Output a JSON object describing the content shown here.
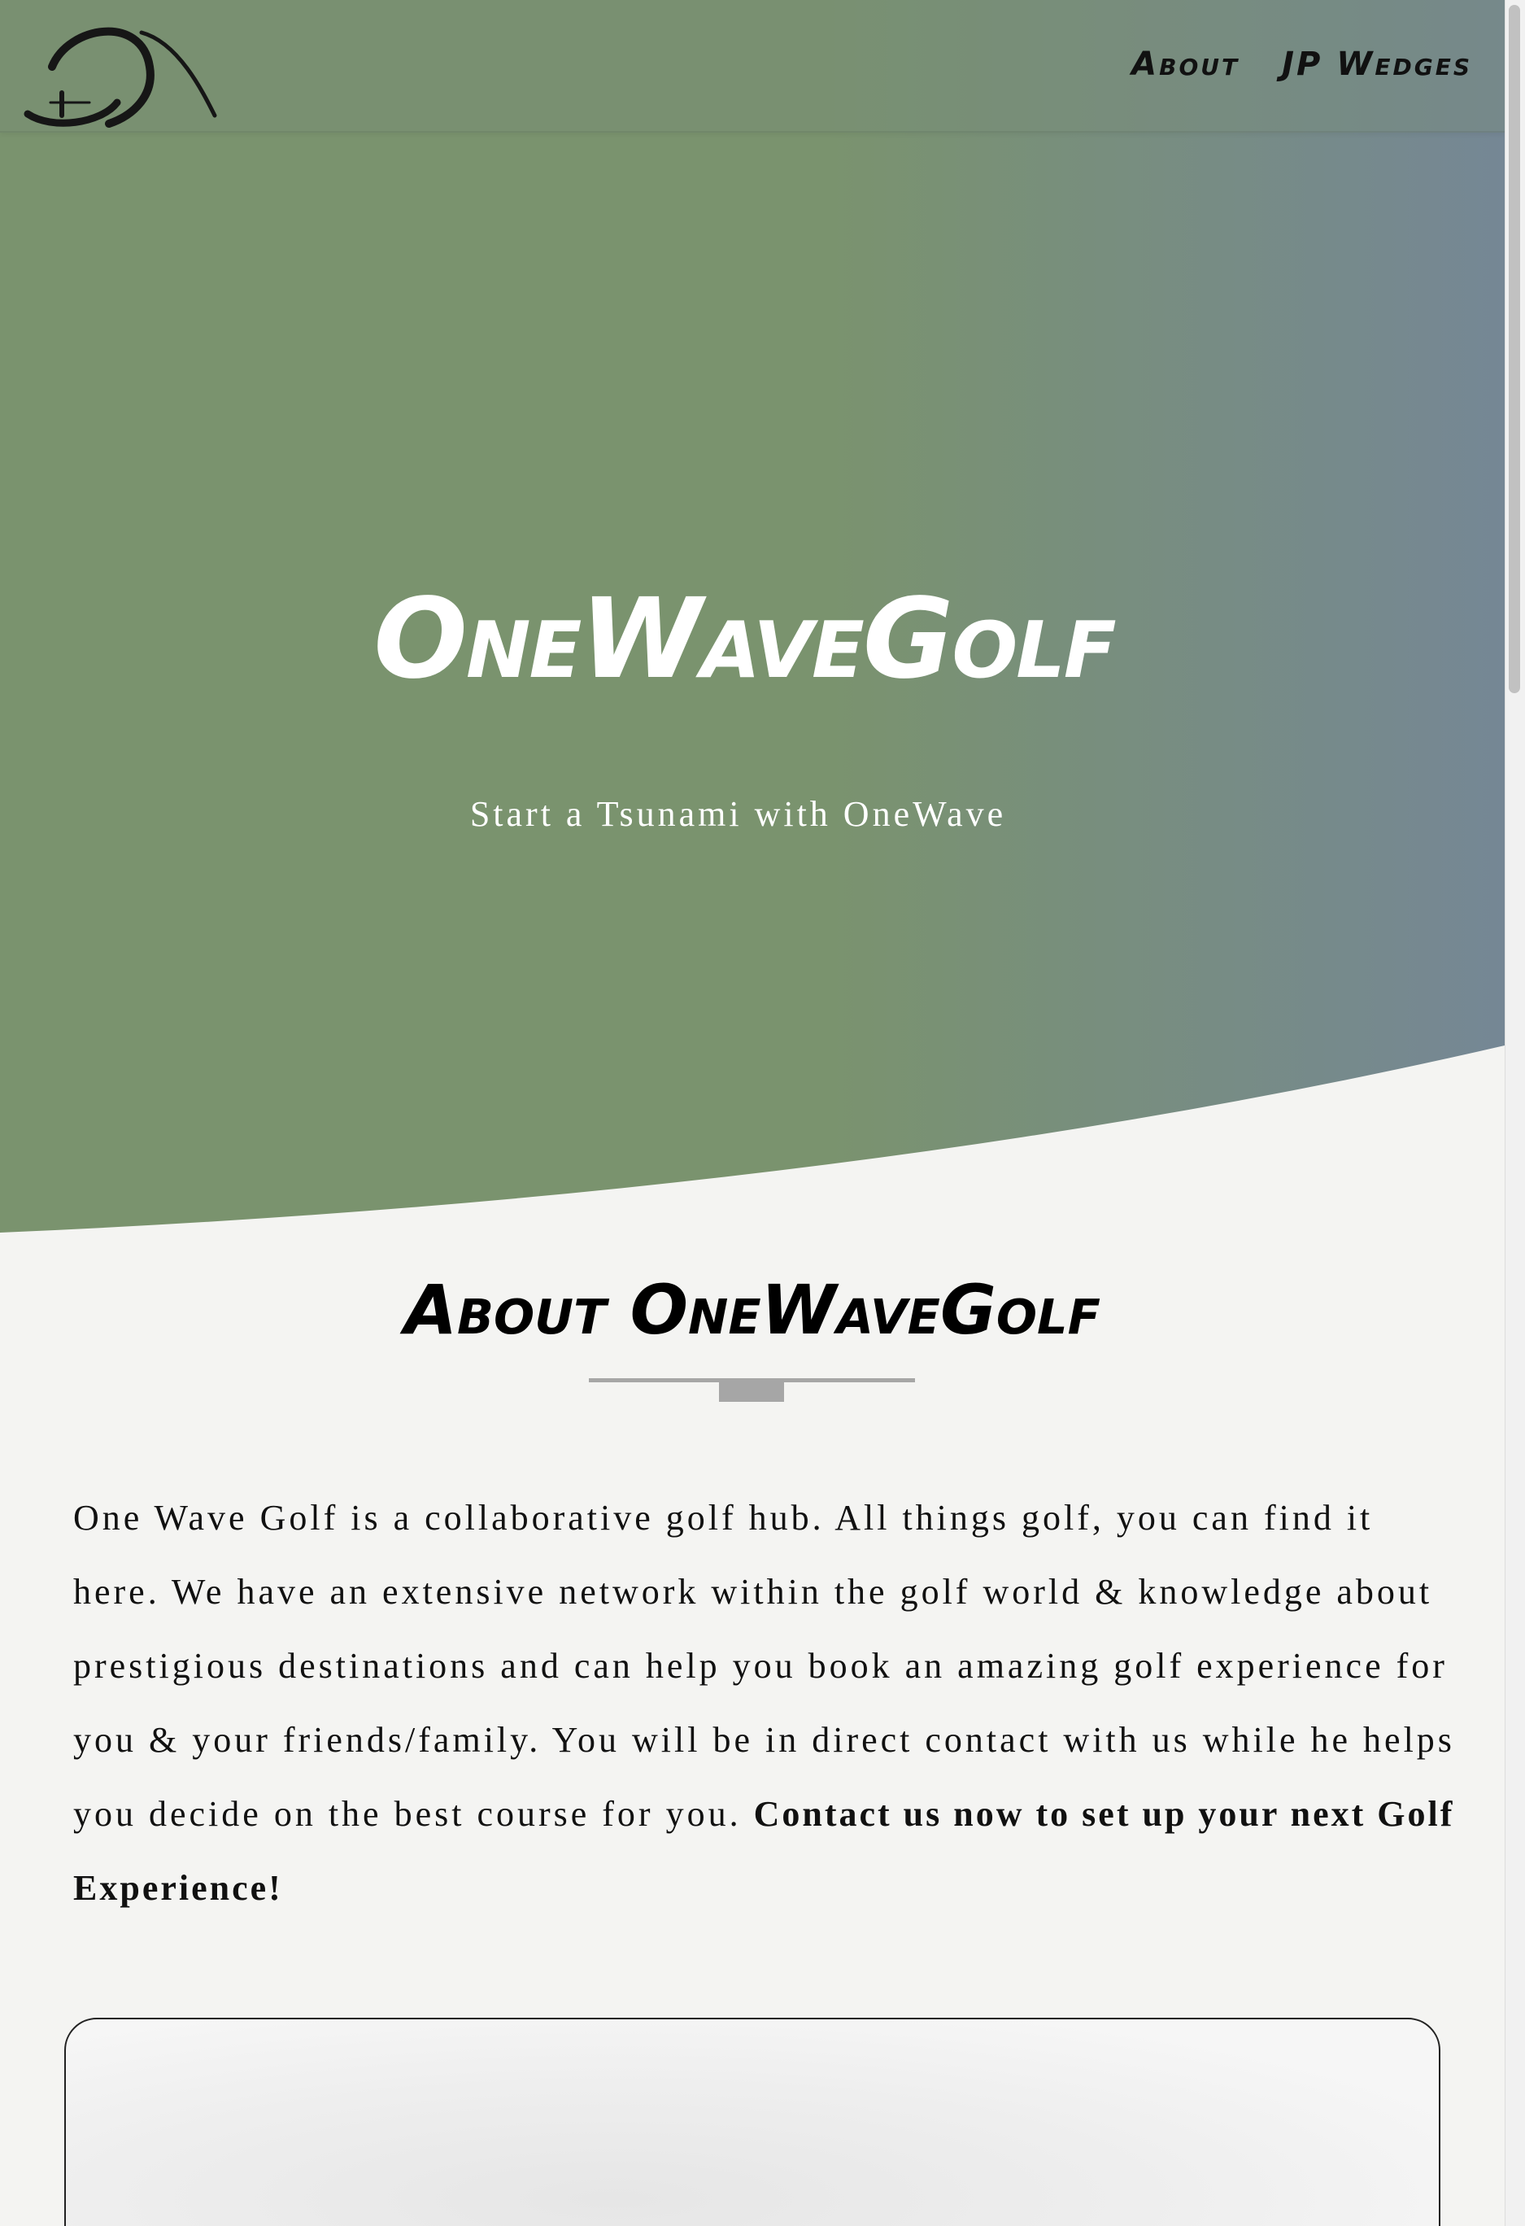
{
  "nav": {
    "logo_icon": "onewave-wave-logo",
    "links": [
      {
        "label": "About"
      },
      {
        "label": "JP Wedges"
      }
    ]
  },
  "hero": {
    "title": "OneWaveGolf",
    "tagline": "Start a Tsunami with OneWave"
  },
  "about": {
    "heading": "About OneWaveGolf",
    "body": "One Wave Golf is a collaborative golf hub. All things golf, you can find it here. We have an extensive network within the golf world & knowledge about prestigious destinations and can help you book an amazing golf experience for you & your friends/family. You will be in direct contact with us while he helps you decide on the best course for you.",
    "cta": "Contact us now to set up your next Golf Experience!"
  },
  "colors": {
    "hero_green": "#7a936e",
    "hero_blue_gray": "#758795",
    "page_background": "#f4f4f2",
    "divider_gray": "#a6a6a6"
  }
}
